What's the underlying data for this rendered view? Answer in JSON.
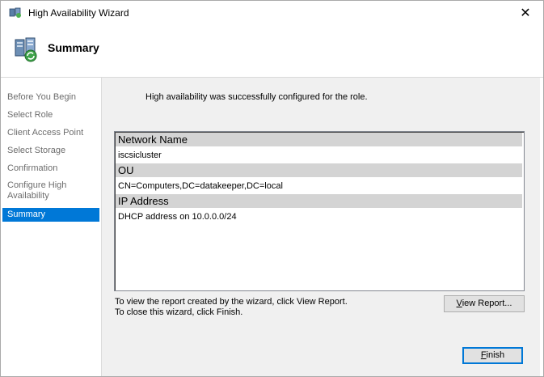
{
  "window": {
    "title": "High Availability Wizard",
    "close_glyph": "✕"
  },
  "header": {
    "title": "Summary"
  },
  "nav": {
    "items": [
      {
        "label": "Before You Begin"
      },
      {
        "label": "Select Role"
      },
      {
        "label": "Client Access Point"
      },
      {
        "label": "Select Storage"
      },
      {
        "label": "Confirmation"
      },
      {
        "label": "Configure High Availability"
      },
      {
        "label": "Summary",
        "active": true
      }
    ]
  },
  "main": {
    "success_message": "High availability was successfully configured for the role.",
    "sections": [
      {
        "heading": "Network Name",
        "value": "iscsicluster"
      },
      {
        "heading": "OU",
        "value": "CN=Computers,DC=datakeeper,DC=local"
      },
      {
        "heading": "IP Address",
        "value": "DHCP address on 10.0.0.0/24"
      }
    ],
    "note_view": "To view the report created by the wizard, click View Report.",
    "note_close": "To close this wizard, click Finish."
  },
  "buttons": {
    "view_report_mnemonic": "V",
    "view_report_rest": "iew Report...",
    "finish_mnemonic": "F",
    "finish_rest": "inish"
  },
  "colors": {
    "accent": "#0078d7",
    "panel": "#f0f0f0",
    "section_header": "#d4d4d4"
  }
}
